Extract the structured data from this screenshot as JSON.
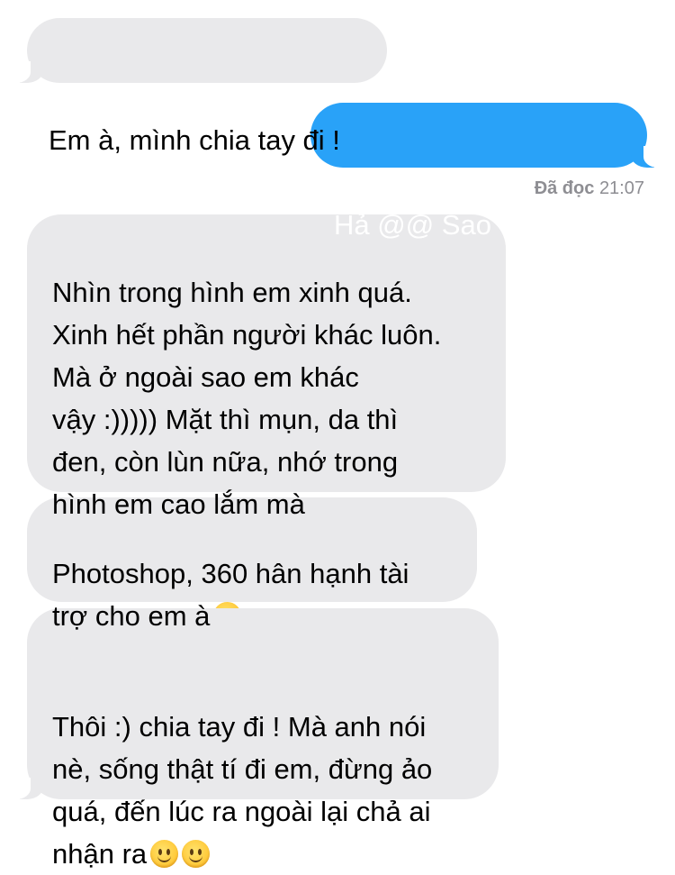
{
  "messages": [
    {
      "from": "other",
      "text": "Em à, mình chia tay đi !"
    },
    {
      "from": "me",
      "text": "Hả @@ Sao vậy a ???"
    },
    {
      "from": "other",
      "text": "Nhìn trong hình em xinh quá.\nXinh hết phần người khác luôn.\nMà ở ngoài sao em khác\nvậy :))))) Mặt thì mụn, da thì\nđen, còn lùn nữa, nhớ trong\nhình em cao lắm mà"
    },
    {
      "from": "other",
      "text": "Photoshop, 360 hân hạnh tài\ntrợ cho em à",
      "emoji": [
        "smirking-face-emoji"
      ]
    },
    {
      "from": "other",
      "text": "Thôi :) chia tay đi ! Mà anh nói\nnè, sống thật tí đi em, đừng ảo\nquá, đến lúc ra ngoài lại chả ai\nnhận ra",
      "emoji": [
        "slightly-smiling-face-emoji",
        "slightly-smiling-face-emoji"
      ]
    }
  ],
  "read_receipt": {
    "label": "Đã đọc",
    "time": "21:07"
  },
  "colors": {
    "sent_bubble": "#29a2f8",
    "received_bubble": "#e9e9eb",
    "receipt_text": "#8e8e93"
  }
}
